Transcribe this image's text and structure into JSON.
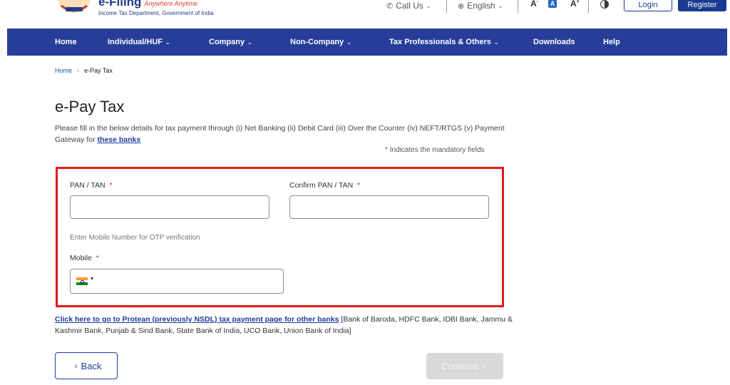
{
  "header": {
    "brand_title": "e-Filing",
    "brand_tagline": "Anywhere Anytime",
    "brand_subtitle": "Income Tax Department, Government of India",
    "call_us": "Call Us",
    "language": "English",
    "font_decrease": "A",
    "font_default": "A",
    "font_increase": "A",
    "login": "Login",
    "register": "Register"
  },
  "nav": {
    "items": [
      {
        "label": "Home",
        "has_dropdown": false
      },
      {
        "label": "Individual/HUF",
        "has_dropdown": true
      },
      {
        "label": "Company",
        "has_dropdown": true
      },
      {
        "label": "Non-Company",
        "has_dropdown": true
      },
      {
        "label": "Tax Professionals & Others",
        "has_dropdown": true
      },
      {
        "label": "Downloads",
        "has_dropdown": false
      },
      {
        "label": "Help",
        "has_dropdown": false
      }
    ]
  },
  "breadcrumb": {
    "home": "Home",
    "current": "e-Pay Tax"
  },
  "page": {
    "title": "e-Pay Tax",
    "description": "Please fill in the below details for tax payment through (i) Net Banking (ii) Debit Card (iii) Over the Counter (iv) NEFT/RTGS (v) Payment Gateway for",
    "description_link": "these banks",
    "mandatory_note": "Indicates the mandatory fields"
  },
  "form": {
    "pan_label": "PAN / TAN",
    "pan_value": "",
    "confirm_pan_label": "Confirm PAN / TAN",
    "confirm_pan_value": "",
    "otp_hint": "Enter Mobile Number for OTP verification",
    "mobile_label": "Mobile",
    "mobile_value": "",
    "required_mark": "*"
  },
  "protean": {
    "link": "Click here to go to Protean (previously NSDL) tax payment page for other banks",
    "banks": "[Bank of Baroda, HDFC Bank, IDBI Bank, Jammu & Kashmir Bank, Punjab & Sind Bank, State Bank of India, UCO Bank, Union Bank of India]"
  },
  "actions": {
    "back": "Back",
    "continue": "Continue"
  },
  "colors": {
    "nav_bg": "#263d9a",
    "accent": "#1f3c9a",
    "highlight_border": "#e01b1b",
    "disabled_button": "#d9d9d9"
  }
}
